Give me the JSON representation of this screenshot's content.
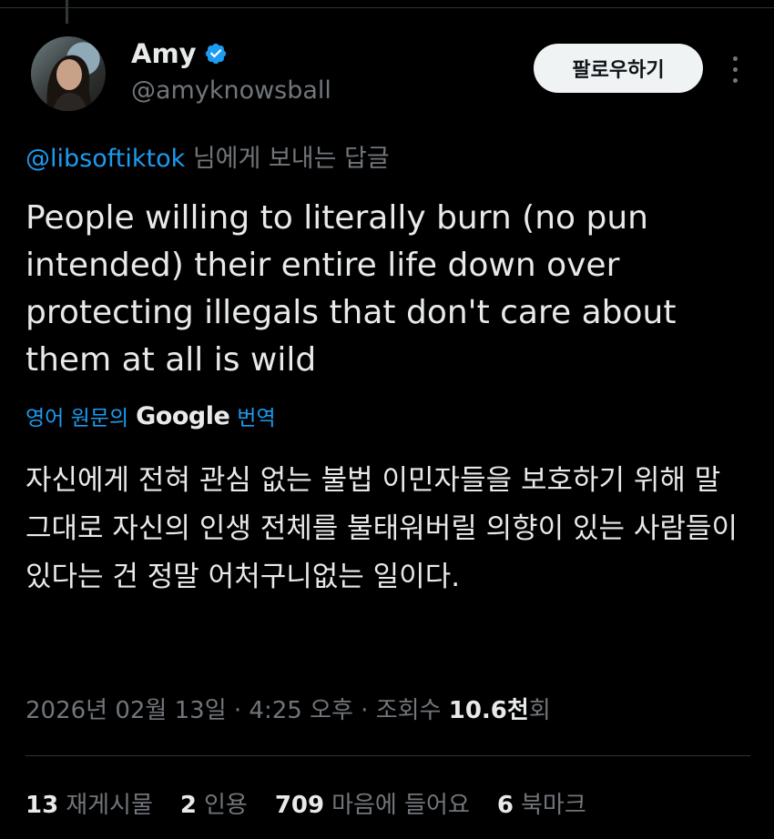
{
  "author": {
    "name": "Amy",
    "handle": "@amyknowsball"
  },
  "follow_button_label": "팔로우하기",
  "reply_context": {
    "mention": "@libsoftiktok",
    "suffix": " 님에게 보내는 답글"
  },
  "tweet": {
    "text": "People willing to literally burn (no pun intended) their entire life down over protecting illegals that don't care about them at all is wild"
  },
  "translation": {
    "prefix": "영어 원문의",
    "provider": "Google",
    "suffix": "번역",
    "text": "자신에게 전혀 관심 없는 불법 이민자들을 보호하기 위해 말 그대로 자신의 인생 전체를 불태워버릴 의향이 있는 사람들이 있다는 건 정말 어처구니없는 일이다."
  },
  "meta": {
    "timestamp": "2026년 02월 13일 · 4:25 오후 · 조회수 ",
    "views": "10.6천",
    "views_suffix": "회"
  },
  "stats": [
    {
      "count": "13",
      "label": "재게시물"
    },
    {
      "count": "2",
      "label": "인용"
    },
    {
      "count": "709",
      "label": "마음에 들어요"
    },
    {
      "count": "6",
      "label": "북마크"
    }
  ],
  "colors": {
    "background": "#000000",
    "accent": "#1d9bf0",
    "secondary_text": "#71767b",
    "primary_text": "#e7e9ea"
  }
}
